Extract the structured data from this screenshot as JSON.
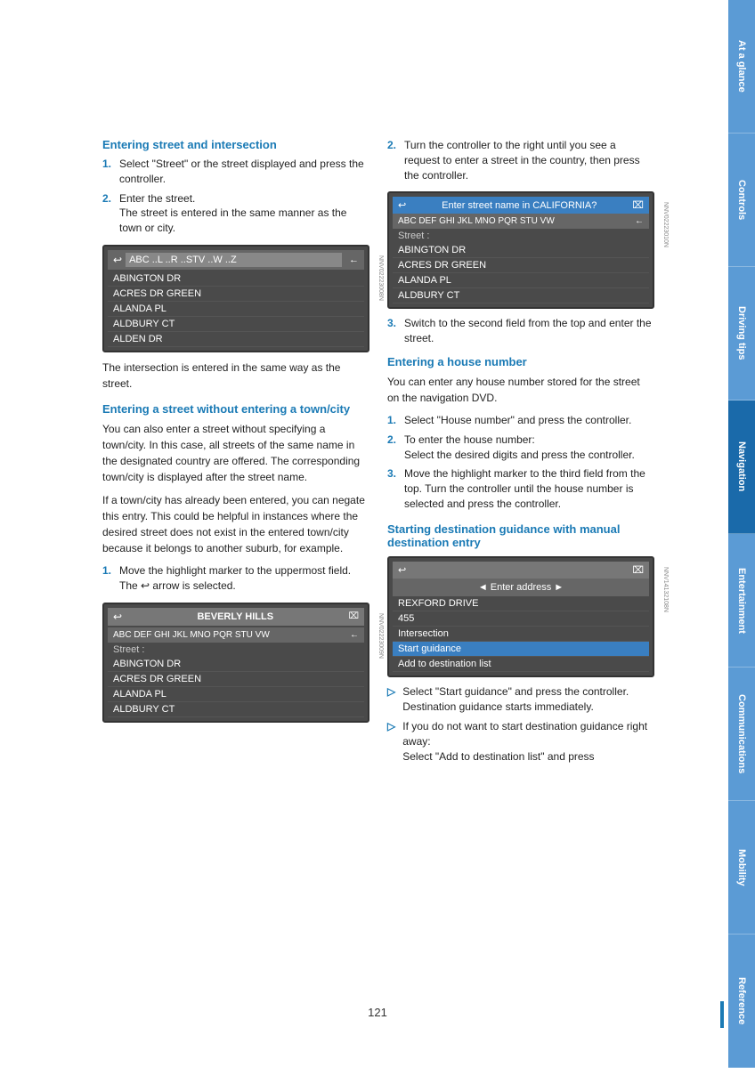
{
  "sidebar": {
    "tabs": [
      {
        "label": "At a glance",
        "color": "tab-blue"
      },
      {
        "label": "Controls",
        "color": "tab-blue"
      },
      {
        "label": "Driving tips",
        "color": "tab-blue"
      },
      {
        "label": "Navigation",
        "color": "tab-active"
      },
      {
        "label": "Entertainment",
        "color": "tab-blue"
      },
      {
        "label": "Communications",
        "color": "tab-blue"
      },
      {
        "label": "Mobility",
        "color": "tab-blue"
      },
      {
        "label": "Reference",
        "color": "tab-blue"
      }
    ]
  },
  "page": {
    "number": "121"
  },
  "left_col": {
    "section1": {
      "title": "Entering street and intersection",
      "steps": [
        {
          "num": "1.",
          "text": "Select \"Street\" or the street displayed and press the controller."
        },
        {
          "num": "2.",
          "text": "Enter the street.\nThe street is entered in the same manner as the town or city."
        }
      ],
      "screen1": {
        "header_icon": "↩",
        "input_text": "ABC ..L ..R ..STV ..W ..Z",
        "arrow": "←",
        "items": [
          "ABINGTON DR",
          "ACRES DR GREEN",
          "ALANDA PL",
          "ALDBURY CT",
          "ALDEN DR"
        ]
      },
      "note": "The intersection is entered in the same way as the street."
    },
    "section2": {
      "title": "Entering a street without entering a town/city",
      "body1": "You can also enter a street without specifying a town/city. In this case, all streets of the same name in the designated country are offered. The corresponding town/city is displayed after the street name.",
      "body2": "If a town/city has already been entered, you can negate this entry. This could be helpful in instances where the desired street does not exist in the entered town/city because it belongs to another suburb, for example.",
      "steps": [
        {
          "num": "1.",
          "text": "Move the highlight marker to the uppermost field.\nThe ↩ arrow is selected."
        }
      ],
      "screen2": {
        "header_text": "BEVERLY HILLS",
        "keyboard_row": "ABC DEF GHI JKL MNO PQR STU VW ←",
        "label": "Street :",
        "items": [
          "ABINGTON DR",
          "ACRES DR GREEN",
          "ALANDA PL",
          "ALDBURY CT"
        ]
      }
    }
  },
  "right_col": {
    "step2_text": "Turn the controller to the right until you see a request to enter a street in the country, then press the controller.",
    "screen_right1": {
      "title": "Enter street name in CALIFORNIA?",
      "keyboard_row": "ABC DEF GHI JKL MNO PQR STU VW ←",
      "label": "Street :",
      "items": [
        "ABINGTON DR",
        "ACRES DR GREEN",
        "ALANDA PL",
        "ALDBURY CT"
      ]
    },
    "step3_text": "Switch to the second field from the top and enter the street.",
    "section_house": {
      "title": "Entering a house number",
      "body": "You can enter any house number stored for the street on the navigation DVD.",
      "steps": [
        {
          "num": "1.",
          "text": "Select \"House number\" and press the controller."
        },
        {
          "num": "2.",
          "text": "To enter the house number:\nSelect the desired digits and press the controller."
        },
        {
          "num": "3.",
          "text": "Move the highlight marker to the third field from the top. Turn the controller until the house number is selected and press the controller."
        }
      ]
    },
    "section_start": {
      "title": "Starting destination guidance with manual destination entry",
      "screen": {
        "header": "◄ Enter address ►",
        "items": [
          "REXFORD DRIVE",
          "455",
          "Intersection",
          "Start guidance",
          "Add to destination list"
        ]
      },
      "notes": [
        "Select \"Start guidance\" and press the controller.\nDestination guidance starts immediately.",
        "If you do not want to start destination guidance right away:\nSelect \"Add to destination list\" and press"
      ]
    }
  }
}
